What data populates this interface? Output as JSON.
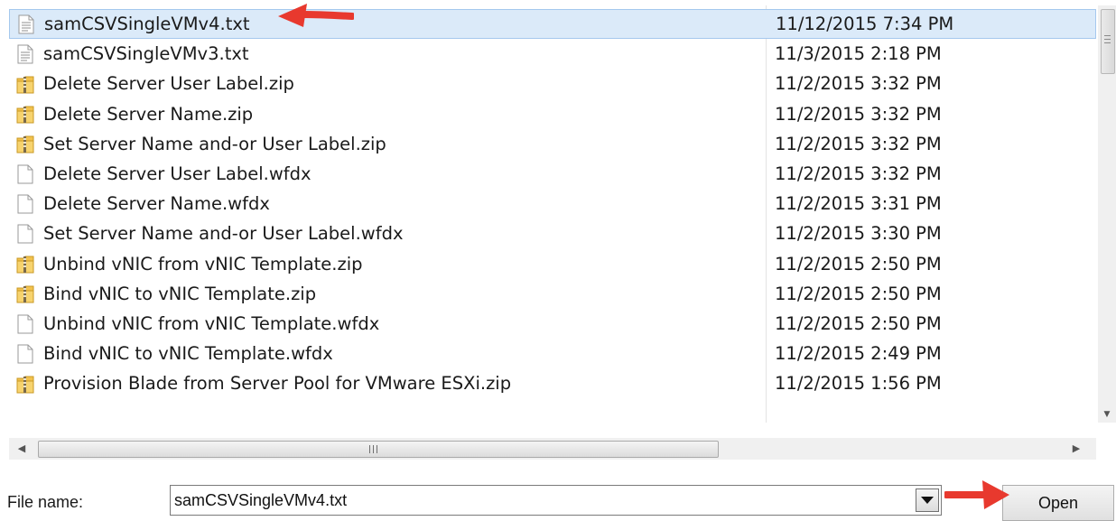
{
  "files": [
    {
      "name": "samCSVSingleVMv4.txt",
      "date": "11/12/2015 7:34 PM",
      "type": "txt",
      "selected": true
    },
    {
      "name": "samCSVSingleVMv3.txt",
      "date": "11/3/2015 2:18 PM",
      "type": "txt",
      "selected": false
    },
    {
      "name": "Delete Server User Label.zip",
      "date": "11/2/2015 3:32 PM",
      "type": "zip",
      "selected": false
    },
    {
      "name": "Delete Server Name.zip",
      "date": "11/2/2015 3:32 PM",
      "type": "zip",
      "selected": false
    },
    {
      "name": "Set Server Name and-or User Label.zip",
      "date": "11/2/2015 3:32 PM",
      "type": "zip",
      "selected": false
    },
    {
      "name": "Delete Server User Label.wfdx",
      "date": "11/2/2015 3:32 PM",
      "type": "doc",
      "selected": false
    },
    {
      "name": "Delete Server Name.wfdx",
      "date": "11/2/2015 3:31 PM",
      "type": "doc",
      "selected": false
    },
    {
      "name": "Set Server Name and-or User Label.wfdx",
      "date": "11/2/2015 3:30 PM",
      "type": "doc",
      "selected": false
    },
    {
      "name": "Unbind vNIC from vNIC Template.zip",
      "date": "11/2/2015 2:50 PM",
      "type": "zip",
      "selected": false
    },
    {
      "name": "Bind vNIC to vNIC Template.zip",
      "date": "11/2/2015 2:50 PM",
      "type": "zip",
      "selected": false
    },
    {
      "name": "Unbind vNIC from vNIC Template.wfdx",
      "date": "11/2/2015 2:50 PM",
      "type": "doc",
      "selected": false
    },
    {
      "name": "Bind vNIC to vNIC Template.wfdx",
      "date": "11/2/2015 2:49 PM",
      "type": "doc",
      "selected": false
    },
    {
      "name": "Provision Blade from Server Pool for VMware ESXi.zip",
      "date": "11/2/2015 1:56 PM",
      "type": "zip",
      "selected": false
    }
  ],
  "footer": {
    "filename_label": "File name:",
    "filename_value": "samCSVSingleVMv4.txt",
    "open_label": "Open"
  },
  "icons": {
    "txt": "text-file-icon",
    "zip": "zip-folder-icon",
    "doc": "blank-file-icon",
    "annotation": "red-arrow-icon"
  },
  "colors": {
    "selection_bg": "#dbeaf9",
    "selection_border": "#a5c8ee",
    "annotation_red": "#e8392e",
    "zip_yellow": "#f2c24e"
  }
}
